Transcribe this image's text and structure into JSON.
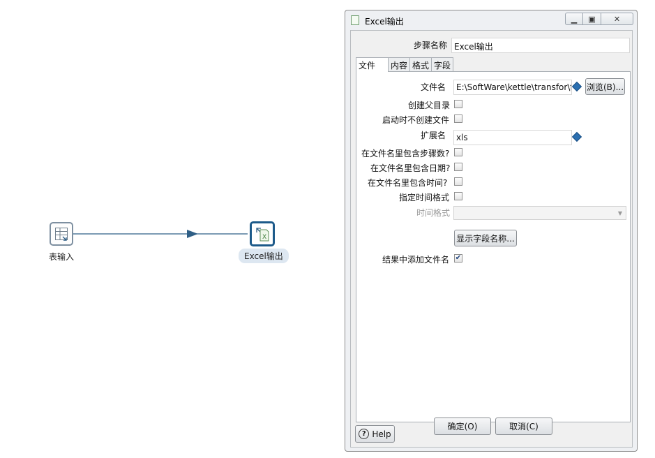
{
  "canvas": {
    "nodes": [
      {
        "label": "表输入",
        "icon": "table-input-icon"
      },
      {
        "label": "Excel输出",
        "icon": "excel-output-icon"
      }
    ],
    "hop_color": "#2f5f86"
  },
  "dialog": {
    "title": "Excel输出",
    "step_name_label": "步骤名称",
    "step_name_value": "Excel输出",
    "tabs": [
      "文件",
      "内容",
      "格式",
      "字段"
    ],
    "active_tab": "文件",
    "fields": {
      "filename_label": "文件名",
      "filename_value": "E:\\SoftWare\\kettle\\transfor\\f",
      "browse_button": "浏览(B)...",
      "create_parent_label": "创建父目录",
      "create_parent_checked": false,
      "no_create_on_start_label": "启动时不创建文件",
      "no_create_on_start_checked": false,
      "extension_label": "扩展名",
      "extension_value": "xls",
      "include_stepnr_label": "在文件名里包含步骤数?",
      "include_stepnr_checked": false,
      "include_date_label": "在文件名里包含日期?",
      "include_date_checked": false,
      "include_time_label": "在文件名里包含时间?",
      "include_time_checked": false,
      "specify_format_label": "指定时间格式",
      "specify_format_checked": false,
      "time_format_label": "时间格式",
      "time_format_value": "",
      "show_fields_button": "显示字段名称...",
      "add_to_result_label": "结果中添加文件名",
      "add_to_result_checked": true
    },
    "buttons": {
      "help": "Help",
      "ok": "确定(O)",
      "cancel": "取消(C)"
    },
    "accent": "#1c5a8a"
  }
}
